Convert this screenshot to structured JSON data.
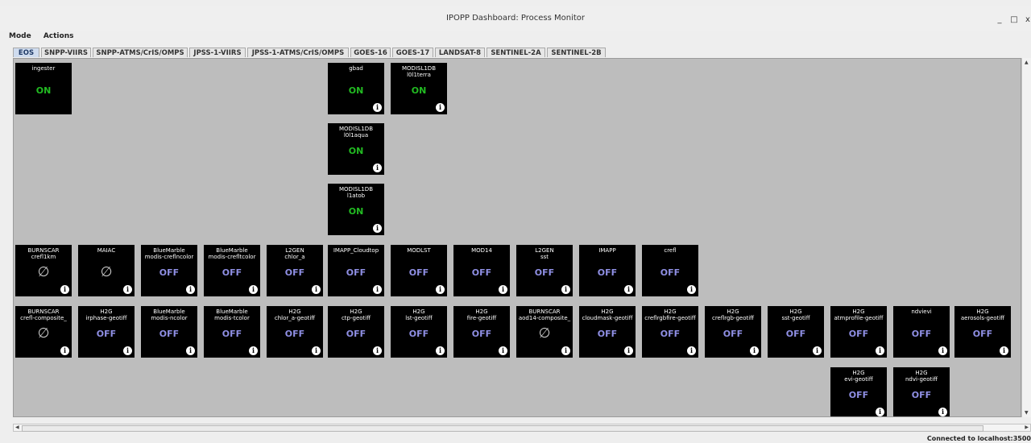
{
  "window": {
    "title": "IPOPP Dashboard: Process Monitor",
    "minimize_glyph": "_",
    "maximize_glyph": "□",
    "close_glyph": "x"
  },
  "menu": {
    "items": [
      "Mode",
      "Actions"
    ]
  },
  "tabs": [
    "EOS",
    "SNPP-VIIRS",
    "SNPP-ATMS/CrIS/OMPS",
    "JPSS-1-VIIRS",
    "JPSS-1-ATMS/CrIS/OMPS",
    "GOES-16",
    "GOES-17",
    "LANDSAT-8",
    "SENTINEL-2A",
    "SENTINEL-2B"
  ],
  "active_tab": "EOS",
  "info_glyph": "i",
  "processes": [
    {
      "name": [
        "ingester"
      ],
      "status": "ON",
      "state": "on",
      "info": false
    },
    {
      "name": [
        "gbad"
      ],
      "status": "ON",
      "state": "on",
      "info": true
    },
    {
      "name": [
        "MODISL1DB",
        "l0l1terra"
      ],
      "status": "ON",
      "state": "on",
      "info": true
    },
    {
      "name": [
        "MODISL1DB",
        "l0l1aqua"
      ],
      "status": "ON",
      "state": "on",
      "info": true
    },
    {
      "name": [
        "MODISL1DB",
        "l1atob"
      ],
      "status": "ON",
      "state": "on",
      "info": true
    },
    {
      "name": [
        "BURNSCAR",
        "crefl1km"
      ],
      "status": "∅",
      "state": "disabled",
      "info": true
    },
    {
      "name": [
        "MAIAC"
      ],
      "status": "∅",
      "state": "disabled",
      "info": true
    },
    {
      "name": [
        "BlueMarble",
        "modis-creflncolor"
      ],
      "status": "OFF",
      "state": "off",
      "info": true
    },
    {
      "name": [
        "BlueMarble",
        "modis-crefltcolor"
      ],
      "status": "OFF",
      "state": "off",
      "info": true
    },
    {
      "name": [
        "L2GEN",
        "chlor_a"
      ],
      "status": "OFF",
      "state": "off",
      "info": true
    },
    {
      "name": [
        "IMAPP_Cloudtop"
      ],
      "status": "OFF",
      "state": "off",
      "info": true
    },
    {
      "name": [
        "MODLST"
      ],
      "status": "OFF",
      "state": "off",
      "info": true
    },
    {
      "name": [
        "MOD14"
      ],
      "status": "OFF",
      "state": "off",
      "info": true
    },
    {
      "name": [
        "L2GEN",
        "sst"
      ],
      "status": "OFF",
      "state": "off",
      "info": true
    },
    {
      "name": [
        "IMAPP"
      ],
      "status": "OFF",
      "state": "off",
      "info": true
    },
    {
      "name": [
        "crefl"
      ],
      "status": "OFF",
      "state": "off",
      "info": true
    },
    {
      "name": [
        "BURNSCAR",
        "crefl-composite_"
      ],
      "status": "∅",
      "state": "disabled",
      "info": true
    },
    {
      "name": [
        "H2G",
        "irphase-geotiff"
      ],
      "status": "OFF",
      "state": "off",
      "info": true
    },
    {
      "name": [
        "BlueMarble",
        "modis-ncolor"
      ],
      "status": "OFF",
      "state": "off",
      "info": true
    },
    {
      "name": [
        "BlueMarble",
        "modis-tcolor"
      ],
      "status": "OFF",
      "state": "off",
      "info": true
    },
    {
      "name": [
        "H2G",
        "chlor_a-geotiff"
      ],
      "status": "OFF",
      "state": "off",
      "info": true
    },
    {
      "name": [
        "H2G",
        "ctp-geotiff"
      ],
      "status": "OFF",
      "state": "off",
      "info": true
    },
    {
      "name": [
        "H2G",
        "lst-geotiff"
      ],
      "status": "OFF",
      "state": "off",
      "info": true
    },
    {
      "name": [
        "H2G",
        "fire-geotiff"
      ],
      "status": "OFF",
      "state": "off",
      "info": true
    },
    {
      "name": [
        "BURNSCAR",
        "aod14-composite_"
      ],
      "status": "∅",
      "state": "disabled",
      "info": true
    },
    {
      "name": [
        "H2G",
        "cloudmask-geotiff"
      ],
      "status": "OFF",
      "state": "off",
      "info": true
    },
    {
      "name": [
        "H2G",
        "creflrgbfire-geotiff"
      ],
      "status": "OFF",
      "state": "off",
      "info": true
    },
    {
      "name": [
        "H2G",
        "creflrgb-geotiff"
      ],
      "status": "OFF",
      "state": "off",
      "info": true
    },
    {
      "name": [
        "H2G",
        "sst-geotiff"
      ],
      "status": "OFF",
      "state": "off",
      "info": true
    },
    {
      "name": [
        "H2G",
        "atmprofile-geotiff"
      ],
      "status": "OFF",
      "state": "off",
      "info": true
    },
    {
      "name": [
        "ndvievi"
      ],
      "status": "OFF",
      "state": "off",
      "info": true
    },
    {
      "name": [
        "H2G",
        "aerosols-geotiff"
      ],
      "status": "OFF",
      "state": "off",
      "info": true
    },
    {
      "name": [
        "H2G",
        "evi-geotiff"
      ],
      "status": "OFF",
      "state": "off",
      "info": true
    },
    {
      "name": [
        "H2G",
        "ndvi-geotiff"
      ],
      "status": "OFF",
      "state": "off",
      "info": true
    }
  ],
  "status_bar": {
    "text": "Connected to localhost:3500"
  }
}
